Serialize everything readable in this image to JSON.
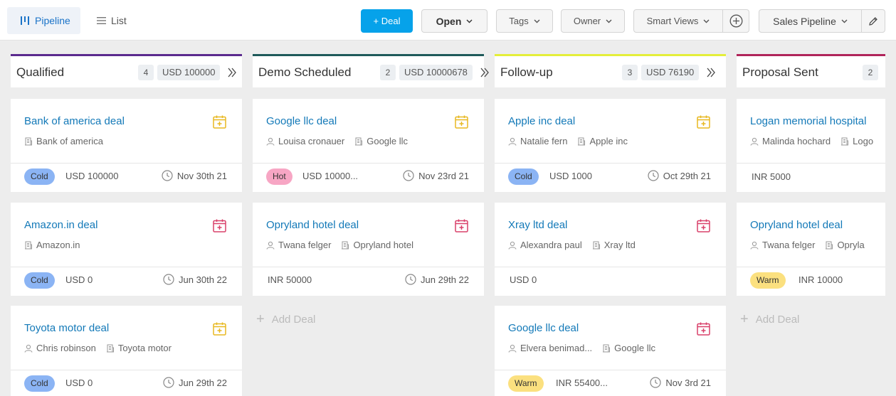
{
  "toolbar": {
    "pipeline_tab": "Pipeline",
    "list_tab": "List",
    "add_deal": "+ Deal",
    "open": "Open",
    "tags": "Tags",
    "owner": "Owner",
    "smart_views": "Smart Views",
    "sales_pipeline": "Sales Pipeline"
  },
  "colors": {
    "accent": "#06a2ea",
    "title_link": "#1379b8",
    "cold": "#8bb4f4",
    "hot": "#f7a6c4",
    "warm": "#fbe07f",
    "calendar_yellow": "#e8b820",
    "calendar_red": "#d9416a"
  },
  "columns": [
    {
      "title": "Qualified",
      "count": "4",
      "amount": "USD 100000",
      "color": "#5b2a8e",
      "cards": [
        {
          "title": "Bank of america deal",
          "contact": "",
          "company": "Bank of america",
          "tag": "Cold",
          "amount": "USD 100000",
          "date": "Nov 30th 21",
          "icon": "calendar-plus-yellow"
        },
        {
          "title": "Amazon.in deal",
          "contact": "",
          "company": "Amazon.in",
          "tag": "Cold",
          "amount": "USD 0",
          "date": "Jun 30th 22",
          "icon": "calendar-plus-red"
        },
        {
          "title": "Toyota motor deal",
          "contact": "Chris robinson",
          "company": "Toyota motor",
          "tag": "Cold",
          "amount": "USD 0",
          "date": "Jun 29th 22",
          "icon": "calendar-plus-yellow"
        }
      ]
    },
    {
      "title": "Demo Scheduled",
      "count": "2",
      "amount": "USD 10000678",
      "color": "#1f5a5a",
      "add_label": "Add Deal",
      "cards": [
        {
          "title": "Google llc deal",
          "contact": "Louisa cronauer",
          "company": "Google llc",
          "tag": "Hot",
          "amount": "USD 10000...",
          "date": "Nov 23rd 21",
          "icon": "calendar-plus-yellow"
        },
        {
          "title": "Opryland hotel deal",
          "contact": "Twana felger",
          "company": "Opryland hotel",
          "tag": "",
          "amount": "INR 50000",
          "date": "Jun 29th 22",
          "icon": "calendar-plus-red"
        }
      ]
    },
    {
      "title": "Follow-up",
      "count": "3",
      "amount": "USD 76190",
      "color": "#e4ee3a",
      "cards": [
        {
          "title": "Apple inc deal",
          "contact": "Natalie fern",
          "company": "Apple inc",
          "tag": "Cold",
          "amount": "USD 1000",
          "date": "Oct 29th 21",
          "icon": "calendar-plus-yellow"
        },
        {
          "title": "Xray ltd deal",
          "contact": "Alexandra paul",
          "company": "Xray ltd",
          "tag": "",
          "amount": "USD 0",
          "date": "",
          "icon": "calendar-plus-red"
        },
        {
          "title": "Google llc deal",
          "contact": "Elvera benimad...",
          "company": "Google llc",
          "tag": "Warm",
          "amount": "INR 55400...",
          "date": "Nov 3rd 21",
          "icon": "calendar-plus-red"
        }
      ]
    },
    {
      "title": "Proposal Sent",
      "count": "2",
      "amount": "",
      "color": "#b0245a",
      "add_label": "Add Deal",
      "cards": [
        {
          "title": "Logan memorial hospital",
          "contact": "Malinda hochard",
          "company": "Logo",
          "tag": "",
          "amount": "INR 5000",
          "date": "",
          "icon": ""
        },
        {
          "title": "Opryland hotel deal",
          "contact": "Twana felger",
          "company": "Opryla",
          "tag": "Warm",
          "amount": "INR 10000",
          "date": "",
          "icon": ""
        }
      ]
    }
  ]
}
